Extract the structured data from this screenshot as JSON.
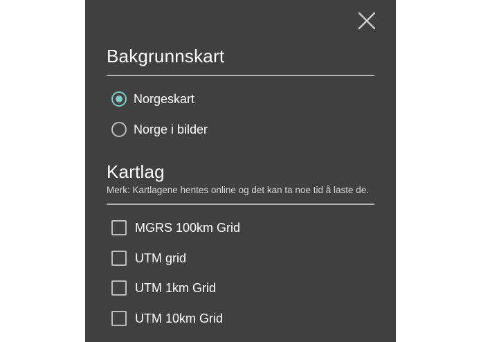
{
  "dialog": {
    "close_icon": "close-icon"
  },
  "background_map": {
    "title": "Bakgrunnskart",
    "options": [
      {
        "label": "Norgeskart",
        "selected": true
      },
      {
        "label": "Norge i bilder",
        "selected": false
      }
    ]
  },
  "map_layers": {
    "title": "Kartlag",
    "note": "Merk: Kartlagene hentes online og det kan ta noe tid å laste de.",
    "layers": [
      {
        "label": "MGRS 100km Grid",
        "checked": false
      },
      {
        "label": "UTM grid",
        "checked": false
      },
      {
        "label": "UTM 1km Grid",
        "checked": false
      },
      {
        "label": "UTM 10km Grid",
        "checked": false
      }
    ]
  },
  "colors": {
    "panel_background": "#404040",
    "accent": "#80cbc4",
    "control_border": "#bdbdbd",
    "text": "#ffffff"
  }
}
